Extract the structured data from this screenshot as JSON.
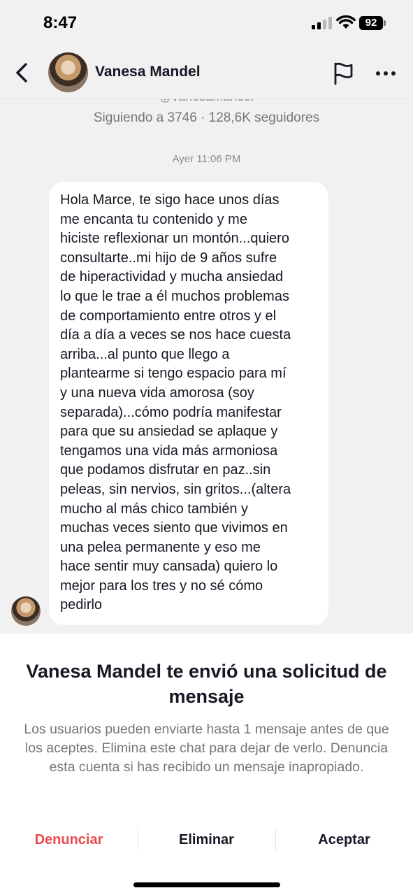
{
  "status_bar": {
    "time": "8:47",
    "battery": "92",
    "icons": [
      "signal-icon",
      "wifi-icon",
      "battery-icon"
    ]
  },
  "header": {
    "name": "Vanesa Mandel",
    "icons": [
      "chevron-left-icon",
      "flag-icon",
      "more-icon"
    ]
  },
  "profile": {
    "handle_partial": "@vanesamandel",
    "stats": "Siguiendo a 3746 · 128,6K seguidores"
  },
  "conversation": {
    "timestamp": "Ayer 11:06 PM",
    "message": "Hola Marce, te sigo hace unos días\nme encanta tu contenido y me\nhiciste reflexionar un montón...quiero\nconsultarte..mi hijo de 9 años sufre\nde hiperactividad y mucha ansiedad\nlo que le trae a él muchos problemas\nde comportamiento entre otros y el\ndía a día a veces se nos hace cuesta\narriba...al punto que llego a\nplantearme si tengo espacio para mí\ny una nueva vida amorosa (soy\nseparada)...cómo podría manifestar\npara que su ansiedad se aplaque y\ntengamos una vida más armoniosa\nque podamos disfrutar en paz..sin\npeleas, sin nervios, sin gritos...(altera\nmucho al más chico también y\nmuchas veces siento que vivimos en\nuna pelea permanente y eso me\nhace sentir muy cansada) quiero lo\nmejor para los tres y no sé cómo\npedirlo"
  },
  "request": {
    "title": "Vanesa Mandel te envió una solicitud de mensaje",
    "description": "Los usuarios pueden enviarte hasta 1 mensaje antes de que los aceptes. Elimina este chat para dejar de verlo. Denuncia esta cuenta si has recibido un mensaje inapropiado.",
    "actions": {
      "report": "Denunciar",
      "delete": "Eliminar",
      "accept": "Aceptar"
    }
  },
  "colors": {
    "background": "#f1f1f2",
    "bubble": "#ffffff",
    "report_red": "#ea4a4f",
    "muted_text": "#75767c",
    "primary_text": "#161823"
  }
}
